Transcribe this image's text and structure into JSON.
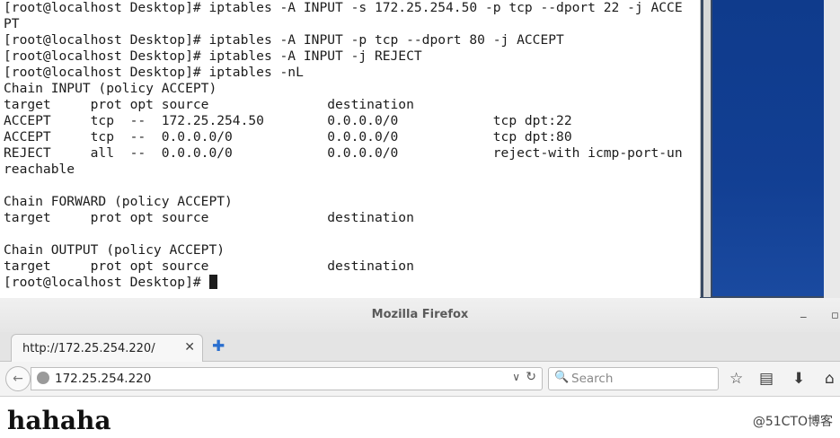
{
  "terminal": {
    "lines": [
      "[root@localhost Desktop]# iptables -A INPUT -s 172.25.254.50 -p tcp --dport 22 -j ACCE",
      "PT",
      "[root@localhost Desktop]# iptables -A INPUT -p tcp --dport 80 -j ACCEPT",
      "[root@localhost Desktop]# iptables -A INPUT -j REJECT",
      "[root@localhost Desktop]# iptables -nL",
      "Chain INPUT (policy ACCEPT)",
      "target     prot opt source               destination",
      "ACCEPT     tcp  --  172.25.254.50        0.0.0.0/0            tcp dpt:22",
      "ACCEPT     tcp  --  0.0.0.0/0            0.0.0.0/0            tcp dpt:80",
      "REJECT     all  --  0.0.0.0/0            0.0.0.0/0            reject-with icmp-port-un",
      "reachable",
      "",
      "Chain FORWARD (policy ACCEPT)",
      "target     prot opt source               destination",
      "",
      "Chain OUTPUT (policy ACCEPT)",
      "target     prot opt source               destination"
    ],
    "prompt": "[root@localhost Desktop]# "
  },
  "firefox": {
    "window_title": "Mozilla Firefox",
    "minimize_glyph": "_",
    "maximize_glyph": "▫",
    "close_glyph": "✕",
    "tab": {
      "title": "http://172.25.254.220/",
      "close_glyph": "✕"
    },
    "new_tab_glyph": "✚",
    "back_glyph": "←",
    "url": "172.25.254.220",
    "url_dropdown_glyph": "∨",
    "reload_glyph": "↻",
    "search_glyph": "🔍",
    "search_placeholder": "Search",
    "bookmark_glyph": "☆",
    "reading_list_glyph": "▤",
    "download_glyph": "⬇",
    "home_glyph": "⌂",
    "page_heading": "hahaha",
    "watermark": "@51CTO博客"
  }
}
